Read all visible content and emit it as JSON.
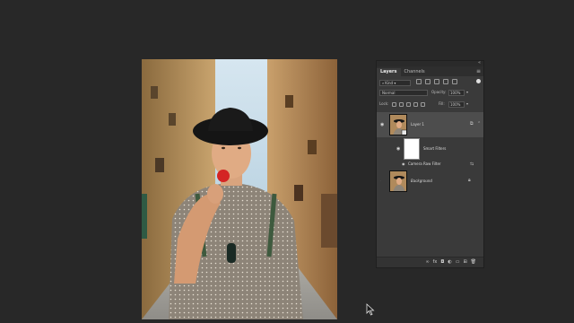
{
  "layers_panel": {
    "tabs": [
      "Layers",
      "Channels"
    ],
    "filter": {
      "kind_label": "Kind"
    },
    "blend_mode": "Normal",
    "opacity": {
      "label": "Opacity:",
      "value": "100%"
    },
    "locks_label": "Lock:",
    "fill": {
      "label": "Fill:",
      "value": "100%"
    },
    "layers": [
      {
        "name": "Layer 1",
        "visible": true,
        "selected": true
      },
      {
        "name": "Smart Filters",
        "visible": true
      },
      {
        "name": "Camera Raw Filter",
        "visible": true
      },
      {
        "name": "Background",
        "visible": false,
        "locked": true
      }
    ]
  },
  "icons": {
    "eye": "eye-icon",
    "lock": "lock-icon",
    "panel_menu": "panel-menu-icon",
    "link_layers": "link-icon",
    "fx": "fx-icon",
    "mask": "mask-icon",
    "adjustment": "adjustment-icon",
    "group": "folder-icon",
    "new_layer": "new-layer-icon",
    "delete": "trash-icon"
  },
  "colors": {
    "workspace_bg": "#282828",
    "panel_bg": "#3a3a3a",
    "selected_row": "#4d4d4d"
  }
}
